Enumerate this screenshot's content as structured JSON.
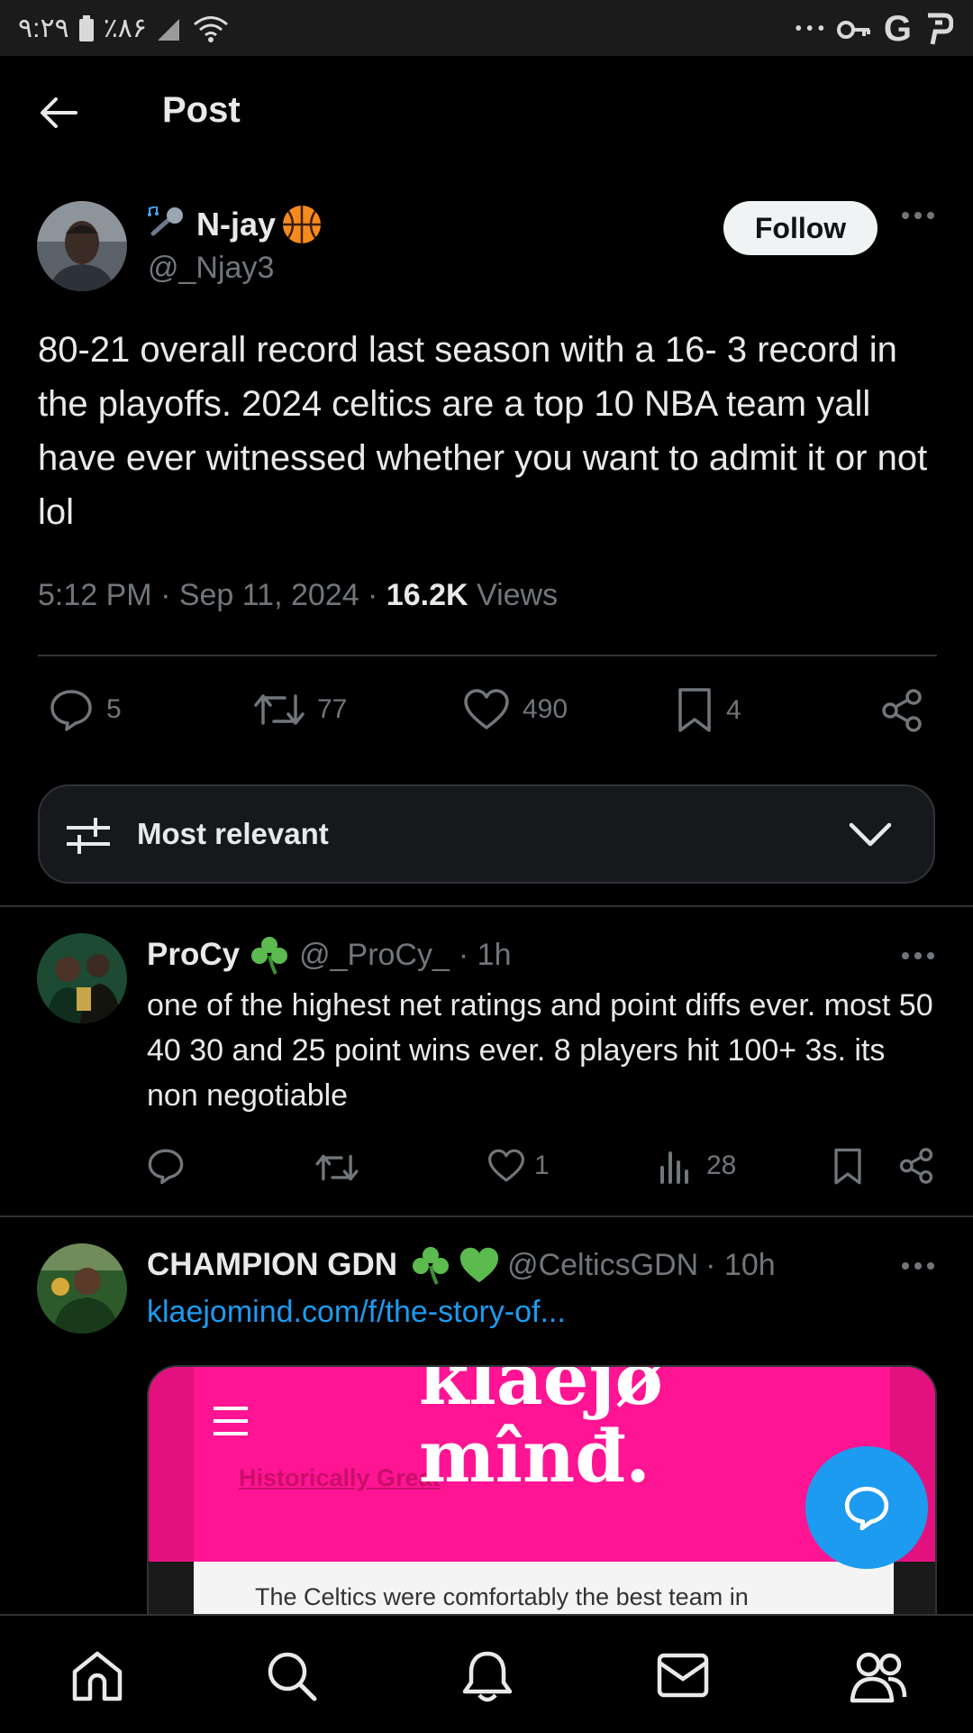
{
  "status_bar": {
    "time": "۹:۲۹",
    "battery": "٪۸۶",
    "dots": "• • •",
    "icons": [
      "battery-icon",
      "signal-icon",
      "wifi-icon",
      "key-icon",
      "google-icon",
      "app-p-icon"
    ]
  },
  "header": {
    "title": "Post"
  },
  "post": {
    "author_name": "N-jay",
    "author_handle": "@_Njay3",
    "follow_label": "Follow",
    "text": "80-21 overall record last season with a 16- 3 record in the playoffs. 2024 celtics are a top 10 NBA team yall have ever witnessed whether you want to admit it or not lol",
    "timestamp": "5:12 PM · Sep 11, 2024 · ",
    "views_count": "16.2K",
    "views_label": "Views",
    "replies": "5",
    "reposts": "77",
    "likes": "490",
    "bookmarks": "4"
  },
  "sort": {
    "label": "Most relevant"
  },
  "replies": [
    {
      "name": "ProCy",
      "handle": "@_ProCy_",
      "time": "· 1h",
      "text": "one of the highest net ratings and point diffs ever. most 50 40 30 and 25 point wins ever. 8 players hit 100+ 3s. its non negotiable",
      "likes": "1",
      "views": "28"
    },
    {
      "name": "CHAMPION GDN",
      "handle": "@CelticsGDN",
      "time": "· 10h",
      "link": "klaejomind.com/f/the-story-of...",
      "card_logo_line1": "klaejø",
      "card_logo_line2": "mînđ.",
      "card_faded": "Historically Great",
      "card_text": "The Celtics were comfortably the best team in"
    }
  ],
  "nav": [
    "home-icon",
    "search-icon",
    "notifications-icon",
    "messages-icon",
    "communities-icon"
  ],
  "colors": {
    "accent": "#1d9bf0",
    "card_pink": "#ff1493",
    "bg": "#000000"
  }
}
